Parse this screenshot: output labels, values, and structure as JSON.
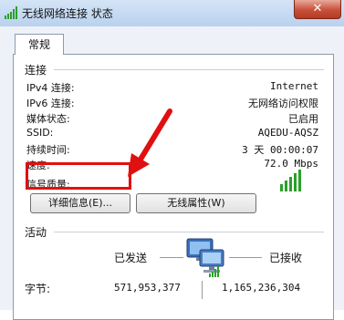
{
  "window": {
    "title": "无线网络连接 状态",
    "close_label": "✕",
    "title_icon": "signal-bars-icon"
  },
  "tabs": [
    {
      "label": "常规"
    }
  ],
  "connection": {
    "section_title": "连接",
    "rows": [
      {
        "label": "IPv4 连接:",
        "value": "Internet"
      },
      {
        "label": "IPv6 连接:",
        "value": "无网络访问权限"
      },
      {
        "label": "媒体状态:",
        "value": "已启用"
      },
      {
        "label": "SSID:",
        "value": "AQEDU-AQSZ"
      },
      {
        "label": "持续时间:",
        "value": "3 天 00:00:07"
      },
      {
        "label": "速度:",
        "value": "72.0 Mbps"
      }
    ],
    "signal_label": "信号质量:",
    "signal_bars_filled": 5,
    "signal_bars_total": 5
  },
  "buttons": {
    "details": "详细信息(E)...",
    "wireless_props": "无线属性(W)"
  },
  "activity": {
    "section_title": "活动",
    "sent_label": "已发送",
    "received_label": "已接收",
    "bytes_label": "字节:",
    "bytes_sent": "571,953,377",
    "bytes_received": "1,165,236,304",
    "network_icon": "network-computers-icon"
  },
  "colors": {
    "annotation_red": "#e01010",
    "signal_green": "#2aa02a"
  }
}
